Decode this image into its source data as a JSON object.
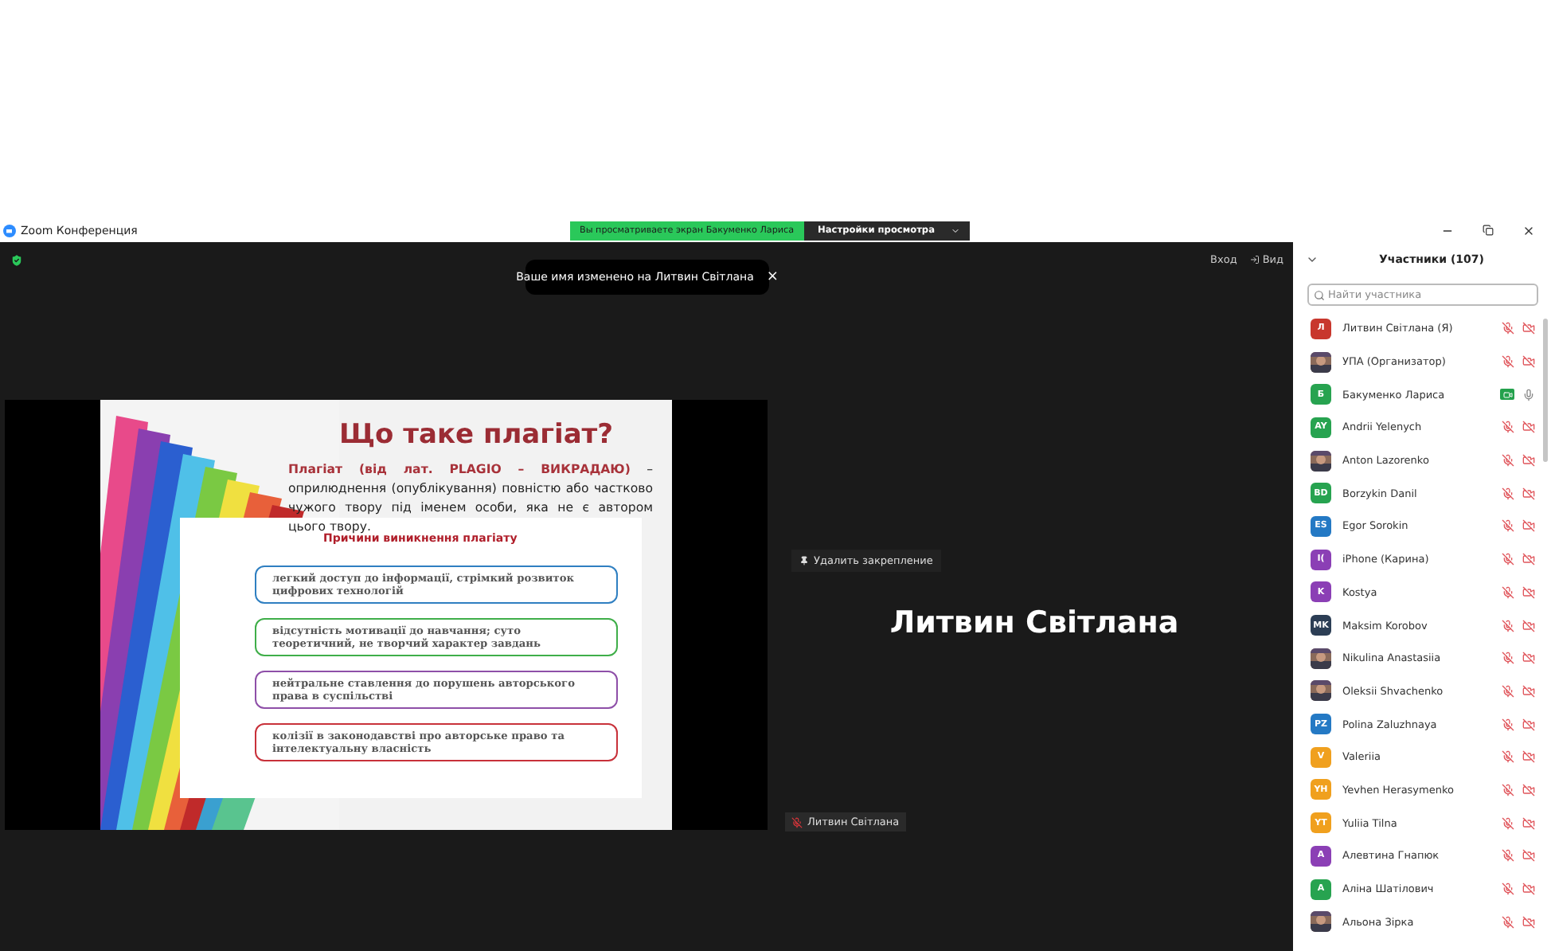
{
  "window": {
    "title": "Zoom Конференция"
  },
  "share_banner": {
    "text": "Вы просматриваете экран Бакуменко Лариса",
    "settings_button": "Настройки просмотра"
  },
  "toast": {
    "text": "Ваше имя изменено на Литвин Світлана",
    "close": "×"
  },
  "toolbar": {
    "sign_in": "Вход",
    "view": "Вид"
  },
  "slide": {
    "title": "Що таке плагіат?",
    "definition": "**Плагіат (від лат. PLAGIO – ВИКРАДАЮ)** – оприлюднення (опублікування) повністю або частково чужого твору під іменем особи, яка не є автором цього твору.",
    "subtitle": "Причини виникнення плагіату",
    "causes": [
      {
        "text": "легкий доступ до інформації, стрімкий розвиток цифрових технологій",
        "color": "#2f7fc1"
      },
      {
        "text": "відсутність мотивації до навчання;  суто теоретичний, не творчий характер завдань",
        "color": "#3fae49"
      },
      {
        "text": "нейтральне ставлення до порушень авторського права в суспільстві",
        "color": "#8e4fa8"
      },
      {
        "text": "колізії в законодавстві про авторське право та інтелектуальну власність",
        "color": "#c8313a"
      }
    ]
  },
  "pinned_video": {
    "unpin": "Удалить закрепление",
    "name": "Литвин Світлана",
    "name_tag": "Литвин Світлана",
    "muted": true
  },
  "participants": {
    "title": "Участники (107)",
    "search": {
      "placeholder": "Найти участника"
    },
    "items": [
      {
        "name": "Литвин Світлана (Я)",
        "kind": "initials",
        "initials": "Л",
        "color": "#c8372d",
        "muted": true,
        "video": false
      },
      {
        "name": "УПА (Организатор)",
        "muted": true,
        "video": false
      },
      {
        "name": "Бакуменко Лариса",
        "kind": "initials",
        "initials": "Б",
        "color": "#27a350",
        "muted": false,
        "video": true
      },
      {
        "name": "Andrii Yelenych",
        "kind": "initials",
        "initials": "AY",
        "color": "#27a350",
        "muted": true,
        "video": false
      },
      {
        "name": "Anton Lazorenko",
        "muted": true,
        "video": false
      },
      {
        "name": "Borzykin Danil",
        "kind": "initials",
        "initials": "BD",
        "color": "#27a350",
        "muted": true,
        "video": false
      },
      {
        "name": "Egor Sorokin",
        "kind": "initials",
        "initials": "ES",
        "color": "#2479c4",
        "muted": true,
        "video": false
      },
      {
        "name": "iPhone (Карина)",
        "kind": "initials",
        "initials": "I(",
        "color": "#8b3fb5",
        "muted": true,
        "video": false
      },
      {
        "name": "Kostya",
        "kind": "initials",
        "initials": "K",
        "color": "#8b3fb5",
        "muted": true,
        "video": false
      },
      {
        "name": "Maksim Korobov",
        "kind": "initials",
        "initials": "MK",
        "color": "#2c3e55",
        "muted": true,
        "video": false
      },
      {
        "name": "Nikulina Anastasiia",
        "muted": true,
        "video": false
      },
      {
        "name": "Oleksii Shvachenko",
        "muted": true,
        "video": false
      },
      {
        "name": "Polina Zaluzhnaya",
        "kind": "initials",
        "initials": "PZ",
        "color": "#2479c4",
        "muted": true,
        "video": false
      },
      {
        "name": "Valeriia",
        "kind": "initials",
        "initials": "V",
        "color": "#f0a01e",
        "muted": true,
        "video": false
      },
      {
        "name": "Yevhen Herasymenko",
        "kind": "initials",
        "initials": "YH",
        "color": "#f0a01e",
        "muted": true,
        "video": false
      },
      {
        "name": "Yuliia Tilna",
        "kind": "initials",
        "initials": "YT",
        "color": "#f0a01e",
        "muted": true,
        "video": false
      },
      {
        "name": "Алевтина Гнапюк",
        "kind": "initials",
        "initials": "А",
        "color": "#8b3fb5",
        "muted": true,
        "video": false
      },
      {
        "name": "Аліна Шатілович",
        "kind": "initials",
        "initials": "А",
        "color": "#27a350",
        "muted": true,
        "video": false
      },
      {
        "name": "Альона Зірка",
        "muted": true,
        "video": false
      }
    ]
  }
}
